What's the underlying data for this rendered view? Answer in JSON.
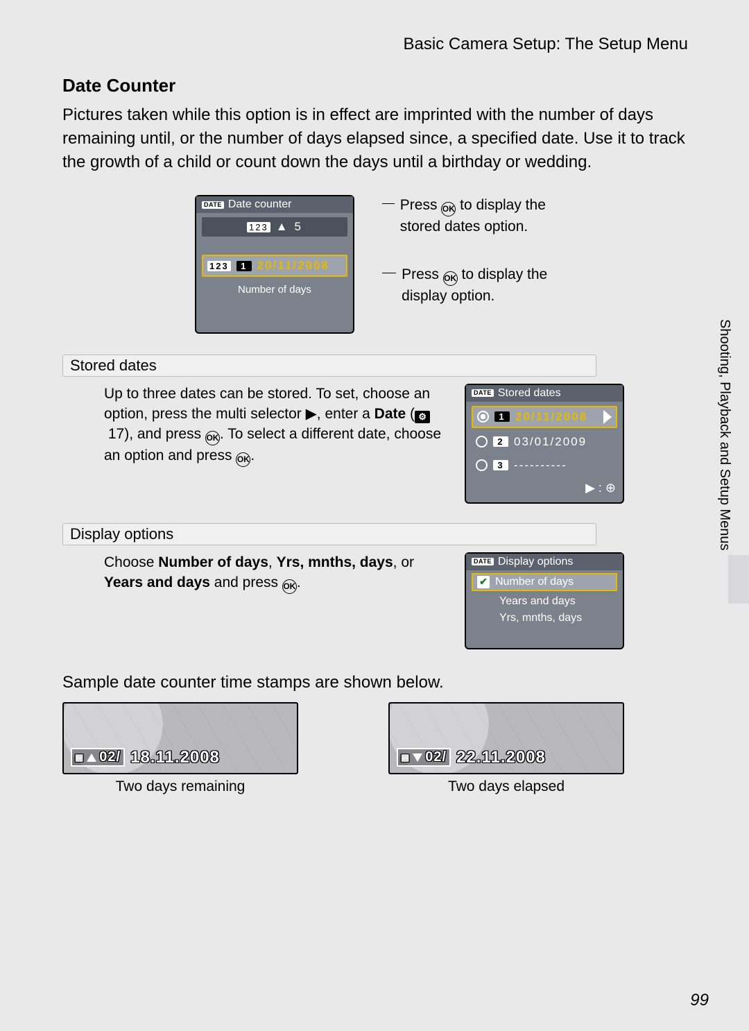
{
  "header": {
    "breadcrumb": "Basic Camera Setup: The Setup Menu"
  },
  "section": {
    "title": "Date Counter",
    "intro": "Pictures taken while this option is in effect are imprinted with the number of days remaining until, or the number of days elapsed since, a specified date. Use it to track the growth of a child or count down the days until a birthday or wedding."
  },
  "fig_main": {
    "lcd_title": "Date counter",
    "counter_value": "5",
    "selected_date": "20/11/2008",
    "footer_label": "Number of days",
    "annot_top": "Press  OK  to display the stored dates option.",
    "annot_bottom": "Press  OK  to display the display option."
  },
  "stored": {
    "title": "Stored dates",
    "text_a": "Up to three dates can be stored. To set, choose an option, press the multi selector ▶, enter a ",
    "text_bold": "Date",
    "text_b": " (",
    "text_ref": "17",
    "text_c": "), and press ",
    "text_d": ". To select a different date, choose an option and press ",
    "lcd_title": "Stored dates",
    "items": [
      {
        "idx": "1",
        "date": "20/11/2008",
        "selected": true
      },
      {
        "idx": "2",
        "date": "03/01/2009",
        "selected": false
      },
      {
        "idx": "3",
        "date": "----------",
        "selected": false
      }
    ]
  },
  "display": {
    "title": "Display options",
    "text_a": "Choose ",
    "opt1": "Number of days",
    "sep": ", ",
    "opt2": "Yrs, mnths, days",
    "sep2": ", or ",
    "opt3": "Years and days",
    "text_b": " and press ",
    "lcd_title": "Display options",
    "items": [
      "Number of days",
      "Years and days",
      "Yrs, mnths, days"
    ]
  },
  "samples": {
    "intro": "Sample date counter time stamps are shown below.",
    "left": {
      "value": "02/",
      "date": "18.11.2008",
      "caption": "Two days remaining"
    },
    "right": {
      "value": "02/",
      "date": "22.11.2008",
      "caption": "Two days elapsed"
    }
  },
  "side_label": "Shooting, Playback and Setup Menus",
  "page_number": "99"
}
